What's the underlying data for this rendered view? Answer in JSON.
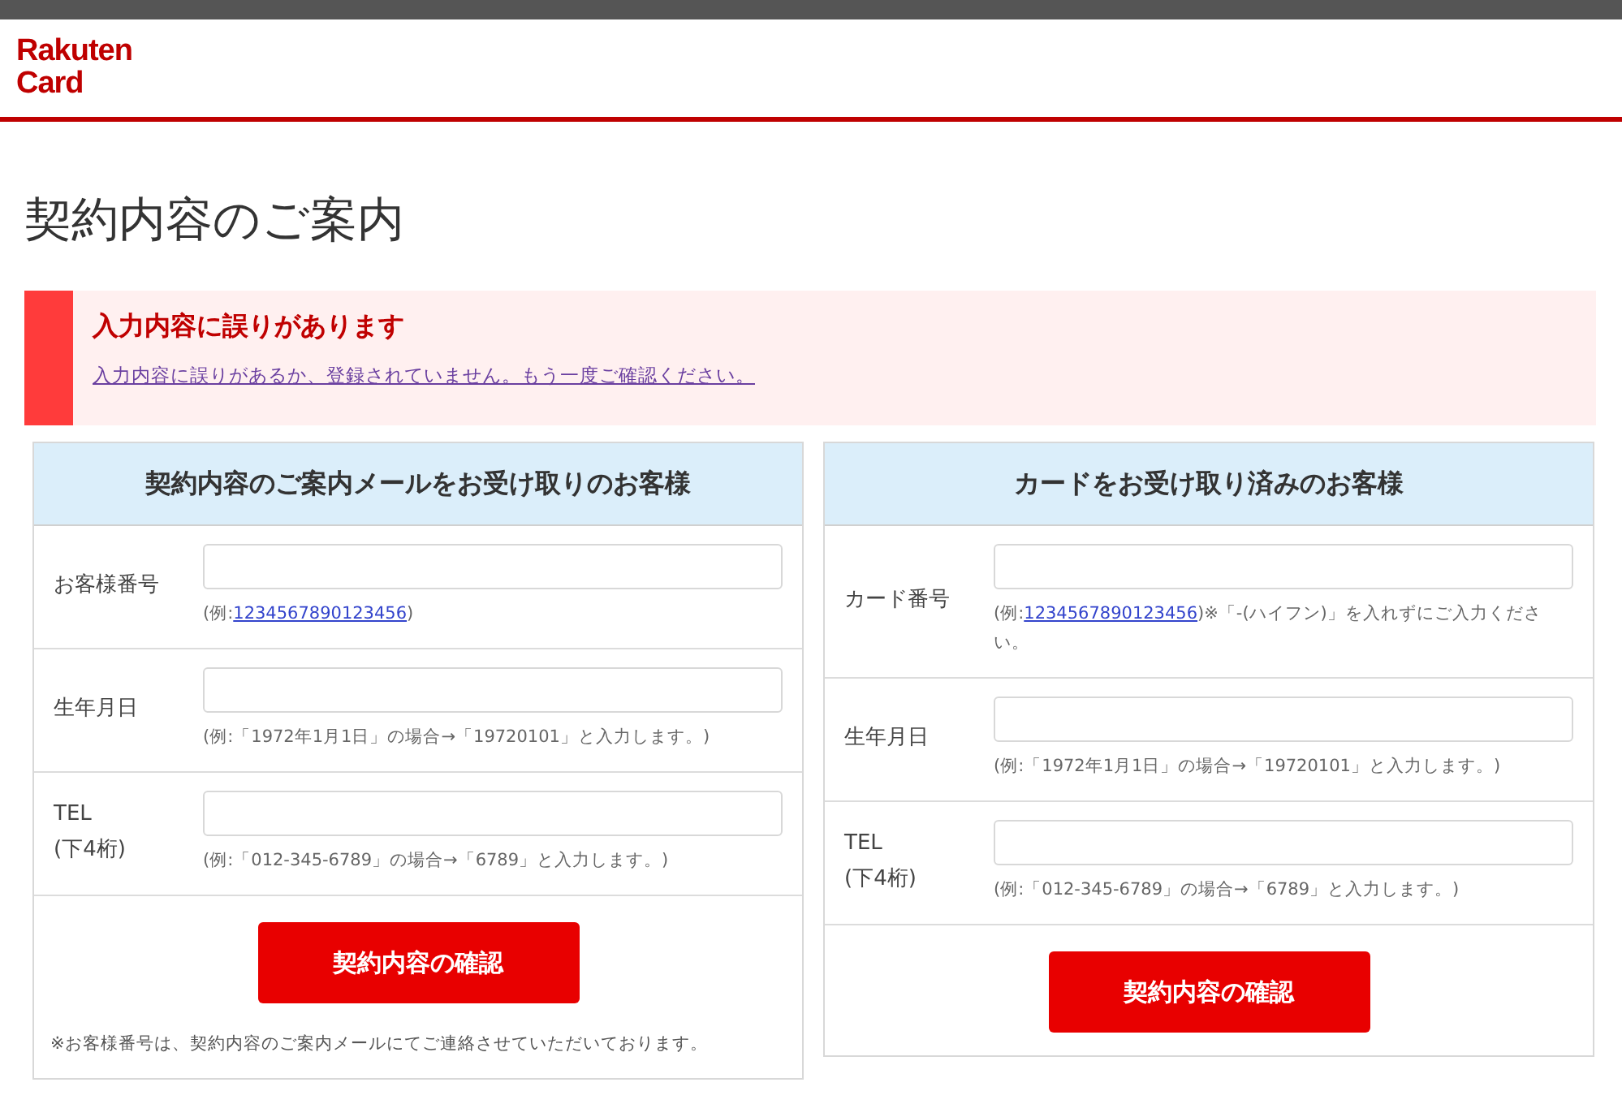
{
  "header": {
    "logo_lines": [
      "Rakuten",
      "Card"
    ]
  },
  "page_title": "契約内容のご案内",
  "error": {
    "title": "入力内容に誤りがあります",
    "message": "入力内容に誤りがあるか、登録されていません。もう一度ご確認ください。"
  },
  "panels": [
    {
      "title": "契約内容のご案内メールをお受け取りのお客様",
      "rows": [
        {
          "label_lines": [
            "お客様番号"
          ],
          "hint_prefix": "(例:",
          "hint_link": "1234567890123456",
          "hint_suffix": ")"
        },
        {
          "label_lines": [
            "生年月日"
          ],
          "hint_prefix": "(例:「1972年1月1日」の場合→「19720101」と入力します。)"
        },
        {
          "label_lines": [
            "TEL",
            "(下4桁)"
          ],
          "hint_prefix": "(例:「012-345-6789」の場合→「6789」と入力します。)"
        }
      ],
      "button": "契約内容の確認",
      "note": "※お客様番号は、契約内容のご案内メールにてご連絡させていただいております。"
    },
    {
      "title": "カードをお受け取り済みのお客様",
      "rows": [
        {
          "label_lines": [
            "カード番号"
          ],
          "hint_prefix": "(例:",
          "hint_link": "1234567890123456",
          "hint_suffix": ")※「-(ハイフン)」を入れずにご入力ください。"
        },
        {
          "label_lines": [
            "生年月日"
          ],
          "hint_prefix": "(例:「1972年1月1日」の場合→「19720101」と入力します。)"
        },
        {
          "label_lines": [
            "TEL",
            "(下4桁)"
          ],
          "hint_prefix": "(例:「012-345-6789」の場合→「6789」と入力します。)"
        }
      ],
      "button": "契約内容の確認"
    }
  ]
}
